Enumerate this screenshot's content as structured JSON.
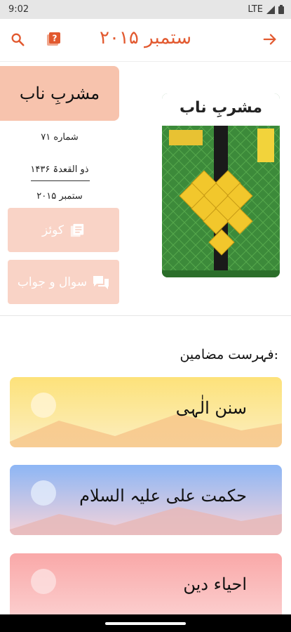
{
  "status": {
    "time": "9:02",
    "network": "LTE"
  },
  "app_bar": {
    "title": "ستمبر ۲۰۱۵"
  },
  "magazine": {
    "name": "مشربِ ناب",
    "issue": "شماره ۷۱",
    "hijri_date": "ذو القعدۃ ۱۴۳۶",
    "month": "ستمبر ۲۰۱۵",
    "cover_title": "مشربِ ناب"
  },
  "actions": {
    "quiz_label": "کوئز",
    "qa_label": "سوال و جواب"
  },
  "toc": {
    "heading": "فہرست مضامین:",
    "items": [
      {
        "label": "سنن الٰہی"
      },
      {
        "label": "حکمت علی علیہ السلام"
      },
      {
        "label": "احیاء دین"
      }
    ]
  },
  "colors": {
    "accent": "#e2592f",
    "title_card": "#f7c3ad",
    "button_bg": "#f9d3c6"
  },
  "icons": [
    "search-icon",
    "help-icon",
    "arrow-right-icon",
    "signal-icon",
    "battery-icon",
    "book-icon",
    "chat-icon"
  ]
}
